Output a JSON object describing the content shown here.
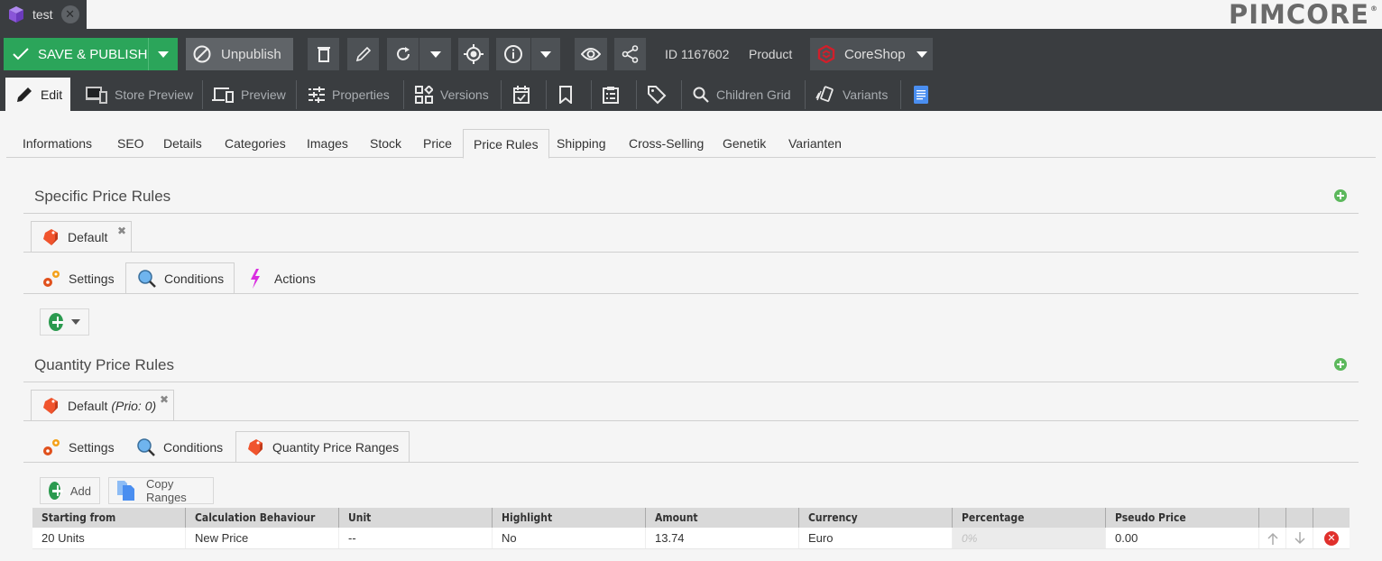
{
  "document_tab": {
    "title": "test",
    "icon": "cube-icon"
  },
  "logo": {
    "text": "PIMCORE"
  },
  "toolbar": {
    "save_publish_label": "SAVE & PUBLISH",
    "unpublish_label": "Unpublish",
    "id_label": "ID 1167602",
    "type_label": "Product",
    "coreshop_label": "CoreShop"
  },
  "editor_tabs": [
    {
      "label": "Edit",
      "icon": "pencil-icon",
      "active": true
    },
    {
      "label": "Store Preview",
      "icon": "devices-icon"
    },
    {
      "label": "Preview",
      "icon": "responsive-preview-icon"
    },
    {
      "label": "Properties",
      "icon": "sliders-icon"
    },
    {
      "label": "Versions",
      "icon": "versions-icon"
    },
    {
      "label": "",
      "icon": "calendar-check-icon"
    },
    {
      "label": "",
      "icon": "bookmark-icon"
    },
    {
      "label": "",
      "icon": "clipboard-list-icon"
    },
    {
      "label": "",
      "icon": "tag-icon"
    },
    {
      "label": "Children Grid",
      "icon": "search-icon"
    },
    {
      "label": "Variants",
      "icon": "variants-icon"
    },
    {
      "label": "",
      "icon": "document-icon"
    }
  ],
  "content_tabs": [
    {
      "label": "Informations"
    },
    {
      "label": "SEO"
    },
    {
      "label": "Details"
    },
    {
      "label": "Categories"
    },
    {
      "label": "Images"
    },
    {
      "label": "Stock"
    },
    {
      "label": "Price"
    },
    {
      "label": "Price Rules",
      "active": true
    },
    {
      "label": "Shipping"
    },
    {
      "label": "Cross-Selling"
    },
    {
      "label": "Genetik"
    },
    {
      "label": "Varianten"
    }
  ],
  "specific_price_rules": {
    "title": "Specific Price Rules",
    "rule_tab": {
      "label": "Default"
    },
    "sub_tabs": [
      {
        "label": "Settings"
      },
      {
        "label": "Conditions",
        "active": true
      },
      {
        "label": "Actions"
      }
    ]
  },
  "quantity_price_rules": {
    "title": "Quantity Price Rules",
    "rule_tab": {
      "label": "Default",
      "prio": "(Prio: 0)"
    },
    "sub_tabs": [
      {
        "label": "Settings"
      },
      {
        "label": "Conditions"
      },
      {
        "label": "Quantity Price Ranges",
        "active": true
      }
    ],
    "add_label": "Add",
    "copy_ranges_label": "Copy Ranges",
    "grid": {
      "columns": [
        "Starting from",
        "Calculation Behaviour",
        "Unit",
        "Highlight",
        "Amount",
        "Currency",
        "Percentage",
        "Pseudo Price"
      ],
      "rows": [
        {
          "starting_from": "20 Units",
          "calculation_behaviour": "New Price",
          "unit": "--",
          "highlight": "No",
          "amount": "13.74",
          "currency": "Euro",
          "percentage": "0%",
          "pseudo_price": "0.00"
        }
      ]
    }
  },
  "colors": {
    "primary_green": "#2ba55a",
    "toolbar_bg": "#3a3d40",
    "danger_red": "#e0302c",
    "tag_orange": "#f0542d"
  }
}
